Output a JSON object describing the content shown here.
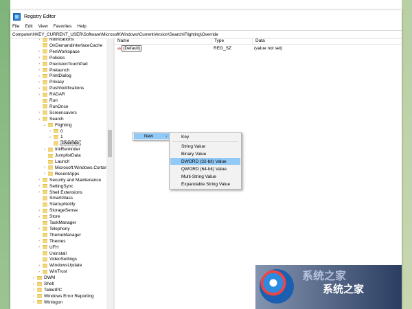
{
  "window": {
    "title": "Registry Editor"
  },
  "menu": [
    "File",
    "Edit",
    "View",
    "Favorites",
    "Help"
  ],
  "address": "Computer\\HKEY_CURRENT_USER\\Software\\Microsoft\\Windows\\CurrentVersion\\Search\\Flighting\\Override",
  "tree": [
    {
      "label": "Notifications",
      "depth": 3,
      "exp": "›"
    },
    {
      "label": "OnDemandInterfaceCache",
      "depth": 3,
      "exp": ""
    },
    {
      "label": "PenWorkspace",
      "depth": 3,
      "exp": "›"
    },
    {
      "label": "Policies",
      "depth": 3,
      "exp": "›"
    },
    {
      "label": "PrecisionTouchPad",
      "depth": 3,
      "exp": "›"
    },
    {
      "label": "Prelaunch",
      "depth": 3,
      "exp": "›"
    },
    {
      "label": "PrintDialog",
      "depth": 3,
      "exp": "›"
    },
    {
      "label": "Privacy",
      "depth": 3,
      "exp": "›"
    },
    {
      "label": "PushNotifications",
      "depth": 3,
      "exp": "›"
    },
    {
      "label": "RADAR",
      "depth": 3,
      "exp": "›"
    },
    {
      "label": "Run",
      "depth": 3,
      "exp": ""
    },
    {
      "label": "RunOnce",
      "depth": 3,
      "exp": ""
    },
    {
      "label": "Screensavers",
      "depth": 3,
      "exp": "›"
    },
    {
      "label": "Search",
      "depth": 3,
      "exp": "⌄"
    },
    {
      "label": "Flighting",
      "depth": 4,
      "exp": "⌄"
    },
    {
      "label": "0",
      "depth": 5,
      "exp": "›"
    },
    {
      "label": "1",
      "depth": 5,
      "exp": "›"
    },
    {
      "label": "Override",
      "depth": 5,
      "exp": "",
      "selected": true
    },
    {
      "label": "InkReminder",
      "depth": 4,
      "exp": "›"
    },
    {
      "label": "JumplistData",
      "depth": 4,
      "exp": ""
    },
    {
      "label": "Launch",
      "depth": 4,
      "exp": ""
    },
    {
      "label": "Microsoft.Windows.Cortana_",
      "depth": 4,
      "exp": "›"
    },
    {
      "label": "RecentApps",
      "depth": 4,
      "exp": "›"
    },
    {
      "label": "Security and Maintenance",
      "depth": 3,
      "exp": "›"
    },
    {
      "label": "SettingSync",
      "depth": 3,
      "exp": "›"
    },
    {
      "label": "Shell Extensions",
      "depth": 3,
      "exp": "›"
    },
    {
      "label": "SmartGlass",
      "depth": 3,
      "exp": ""
    },
    {
      "label": "StartupNotify",
      "depth": 3,
      "exp": ""
    },
    {
      "label": "StorageSense",
      "depth": 3,
      "exp": "›"
    },
    {
      "label": "Store",
      "depth": 3,
      "exp": "›"
    },
    {
      "label": "TaskManager",
      "depth": 3,
      "exp": ""
    },
    {
      "label": "Telephony",
      "depth": 3,
      "exp": "›"
    },
    {
      "label": "ThemeManager",
      "depth": 3,
      "exp": ""
    },
    {
      "label": "Themes",
      "depth": 3,
      "exp": "›"
    },
    {
      "label": "UFH",
      "depth": 3,
      "exp": "›"
    },
    {
      "label": "Uninstall",
      "depth": 3,
      "exp": ""
    },
    {
      "label": "VideoSettings",
      "depth": 3,
      "exp": ""
    },
    {
      "label": "WindowsUpdate",
      "depth": 3,
      "exp": "›"
    },
    {
      "label": "WinTrust",
      "depth": 3,
      "exp": "›"
    },
    {
      "label": "DWM",
      "depth": 2,
      "exp": "›"
    },
    {
      "label": "Shell",
      "depth": 2,
      "exp": "›"
    },
    {
      "label": "TabletPC",
      "depth": 2,
      "exp": "›"
    },
    {
      "label": "Windows Error Reporting",
      "depth": 2,
      "exp": "›"
    },
    {
      "label": "Winlogon",
      "depth": 2,
      "exp": "›"
    }
  ],
  "columns": {
    "name": "Name",
    "type": "Type",
    "data": "Data"
  },
  "values": [
    {
      "name": "(Default)",
      "type": "REG_SZ",
      "data": "(value not set)"
    }
  ],
  "context_menu": {
    "new": "New",
    "arrow": "›"
  },
  "submenu": {
    "key": "Key",
    "string": "String Value",
    "binary": "Binary Value",
    "dword": "DWORD (32-bit) Value",
    "qword": "QWORD (64-bit) Value",
    "multi": "Multi-String Value",
    "expandable": "Expandable String Value"
  },
  "watermark": {
    "text": "系统之家"
  }
}
